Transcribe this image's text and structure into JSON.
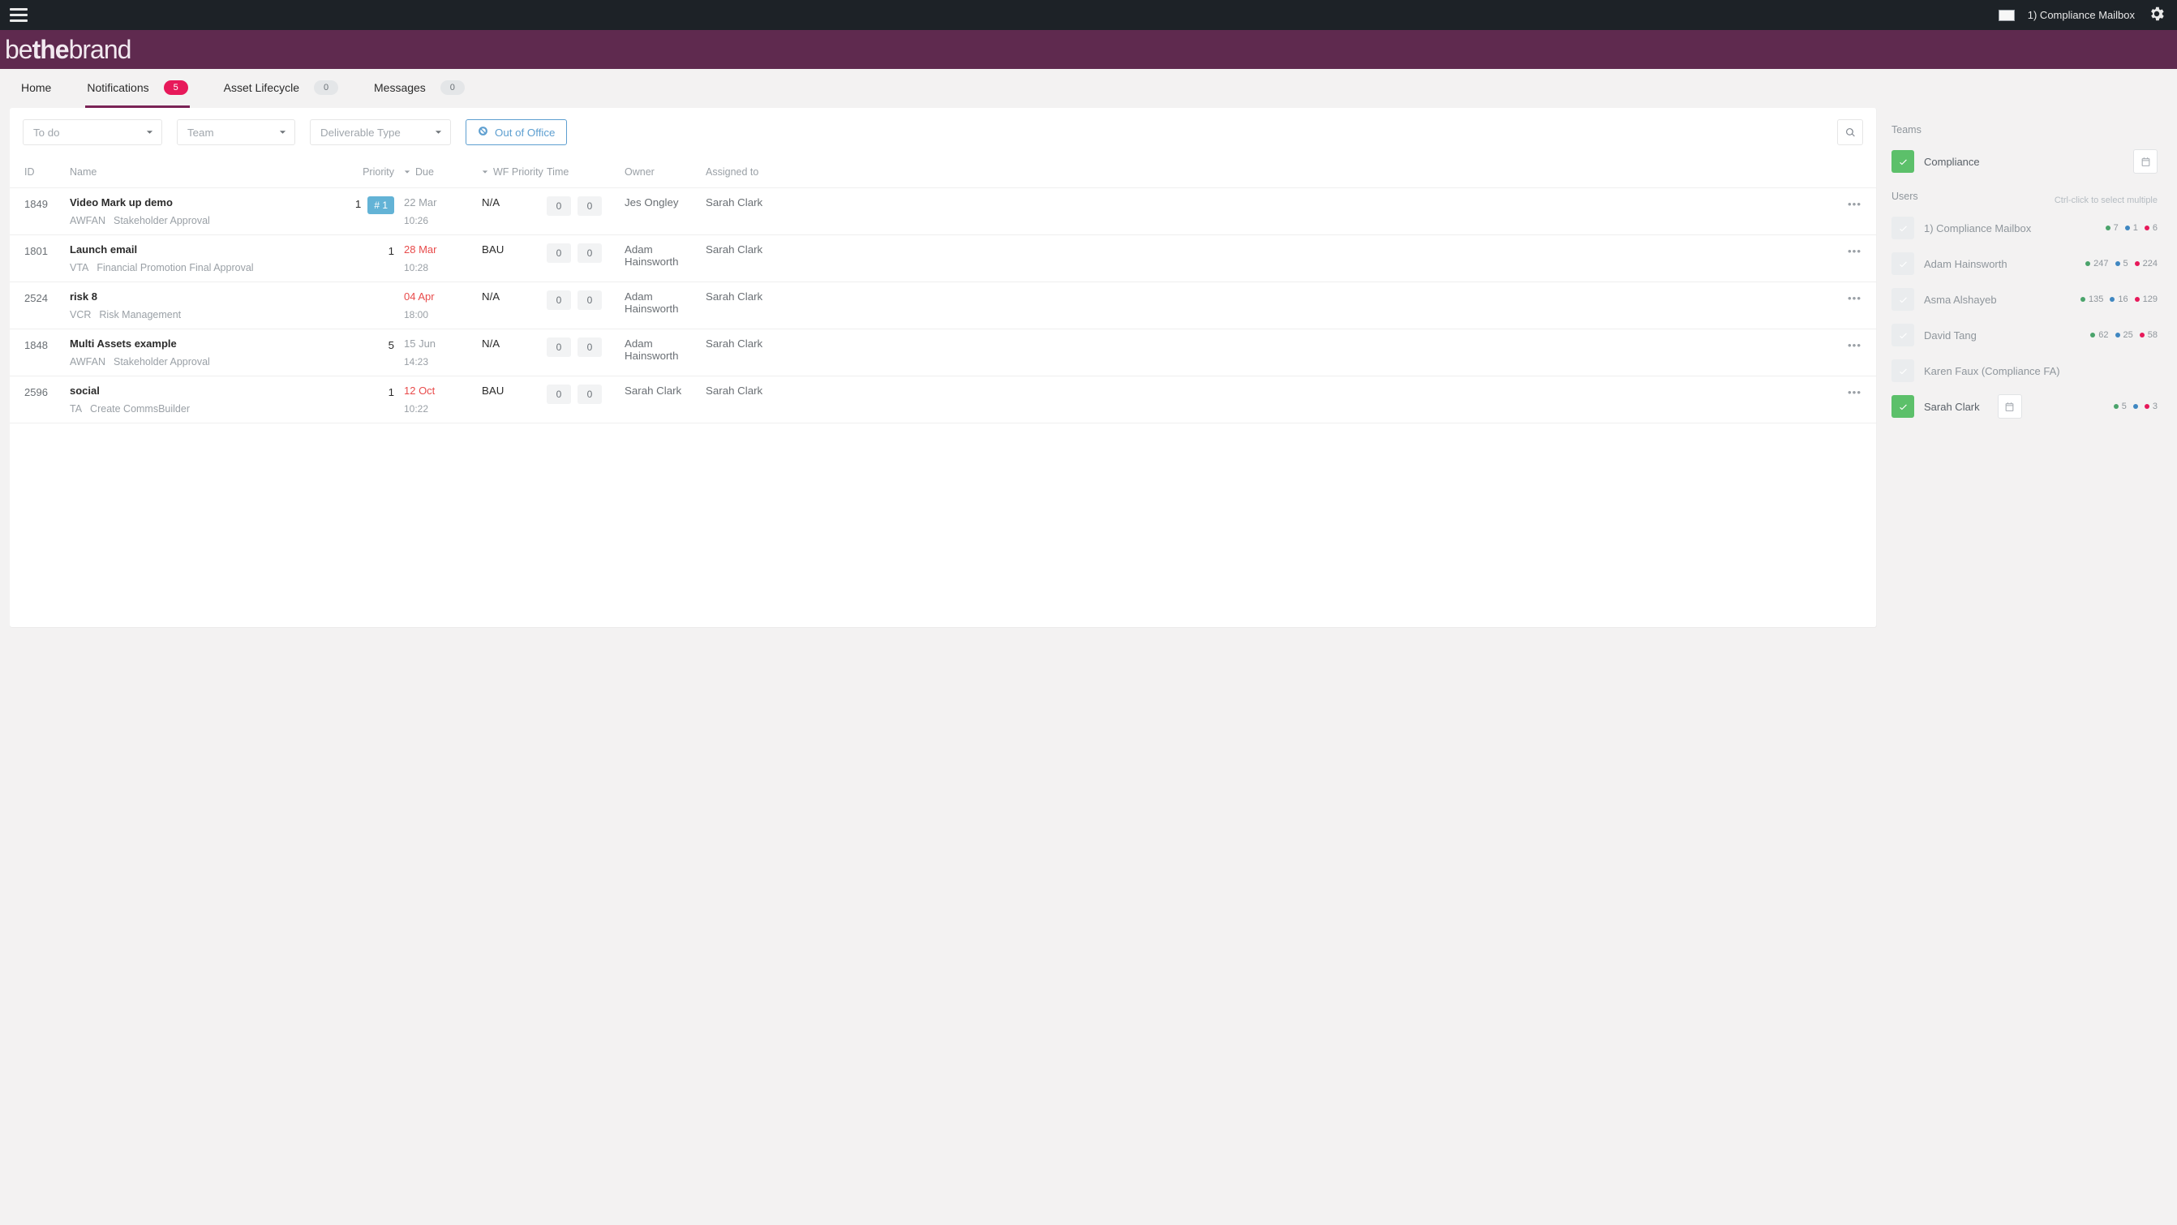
{
  "topbar": {
    "user_label": "1) Compliance Mailbox"
  },
  "brand": {
    "thin": "be",
    "bold": "the",
    "rest": "brand"
  },
  "nav": {
    "home": "Home",
    "notifications": "Notifications",
    "notifications_count": "5",
    "asset_lifecycle": "Asset Lifecycle",
    "asset_lifecycle_count": "0",
    "messages": "Messages",
    "messages_count": "0"
  },
  "filters": {
    "status": "To do",
    "team": "Team",
    "deliverable": "Deliverable Type",
    "out_of_office": "Out of Office"
  },
  "table": {
    "headers": {
      "id": "ID",
      "name": "Name",
      "priority": "Priority",
      "due": "Due",
      "wf_priority": "WF Priority",
      "time": "Time",
      "owner": "Owner",
      "assigned_to": "Assigned to"
    },
    "rows": [
      {
        "id": "1849",
        "name": "Video Mark up demo",
        "code": "AWFAN",
        "sub": "Stakeholder Approval",
        "priority": "1",
        "priority_badge": "# 1",
        "due": "22 Mar",
        "due_color": "grey",
        "due_time": "10:26",
        "wf": "N/A",
        "time_a": "0",
        "time_b": "0",
        "owner": "Jes Ongley",
        "assigned": "Sarah Clark"
      },
      {
        "id": "1801",
        "name": "Launch email",
        "code": "VTA",
        "sub": "Financial Promotion Final Approval",
        "priority": "1",
        "priority_badge": "",
        "due": "28 Mar",
        "due_color": "red",
        "due_time": "10:28",
        "wf": "BAU",
        "time_a": "0",
        "time_b": "0",
        "owner": "Adam Hainsworth",
        "assigned": "Sarah Clark"
      },
      {
        "id": "2524",
        "name": "risk 8",
        "code": "VCR",
        "sub": "Risk Management",
        "priority": "",
        "priority_badge": "",
        "due": "04 Apr",
        "due_color": "red",
        "due_time": "18:00",
        "wf": "N/A",
        "time_a": "0",
        "time_b": "0",
        "owner": "Adam Hainsworth",
        "assigned": "Sarah Clark"
      },
      {
        "id": "1848",
        "name": "Multi Assets example",
        "code": "AWFAN",
        "sub": "Stakeholder Approval",
        "priority": "5",
        "priority_badge": "",
        "due": "15 Jun",
        "due_color": "grey",
        "due_time": "14:23",
        "wf": "N/A",
        "time_a": "0",
        "time_b": "0",
        "owner": "Adam Hainsworth",
        "assigned": "Sarah Clark"
      },
      {
        "id": "2596",
        "name": "social",
        "code": "TA",
        "sub": "Create CommsBuilder",
        "priority": "1",
        "priority_badge": "",
        "due": "12 Oct",
        "due_color": "red",
        "due_time": "10:22",
        "wf": "BAU",
        "time_a": "0",
        "time_b": "0",
        "owner": "Sarah Clark",
        "assigned": "Sarah Clark"
      }
    ]
  },
  "side": {
    "teams_title": "Teams",
    "team_compliance": "Compliance",
    "users_title": "Users",
    "users_hint": "Ctrl-click to select multiple",
    "users": [
      {
        "name": "1) Compliance Mailbox",
        "active": false,
        "stats": {
          "green": "7",
          "blue": "1",
          "pink": "6"
        }
      },
      {
        "name": "Adam Hainsworth",
        "active": false,
        "stats": {
          "green": "247",
          "blue": "5",
          "pink": "224"
        }
      },
      {
        "name": "Asma Alshayeb",
        "active": false,
        "stats": {
          "green": "135",
          "blue": "16",
          "pink": "129"
        }
      },
      {
        "name": "David Tang",
        "active": false,
        "stats": {
          "green": "62",
          "blue": "25",
          "pink": "58"
        }
      },
      {
        "name": "Karen Faux (Compliance FA)",
        "active": false,
        "stats": null
      },
      {
        "name": "Sarah Clark",
        "active": true,
        "stats": {
          "green": "5",
          "blue": "",
          "pink": "3"
        }
      }
    ]
  },
  "icons": {
    "row_actions": "•••"
  }
}
